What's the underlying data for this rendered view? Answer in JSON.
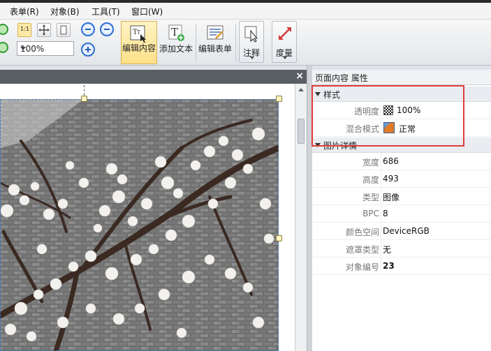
{
  "menu": [
    "表单(R)",
    "对象(B)",
    "工具(T)",
    "窗口(W)"
  ],
  "toolbar": {
    "zoom": "100%",
    "edit_content": "编辑内容",
    "add_text": "添加文本",
    "edit_form": "编辑表单",
    "annotate": "注释",
    "measure": "度量",
    "fit_label": "1:1"
  },
  "doc": {
    "close_glyph": "×"
  },
  "panel": {
    "title": "页面内容 属性",
    "style_group": "样式",
    "image_group": "图片详情",
    "style_props": [
      {
        "key": "透明度",
        "value": "100%"
      },
      {
        "key": "混合模式",
        "value": "正常"
      }
    ],
    "image_props": [
      {
        "key": "宽度",
        "value": "686"
      },
      {
        "key": "高度",
        "value": "493"
      },
      {
        "key": "类型",
        "value": "图像"
      },
      {
        "key": "BPC",
        "value": "8"
      },
      {
        "key": "颜色空间",
        "value": "DeviceRGB"
      },
      {
        "key": "遮罩类型",
        "value": "无"
      },
      {
        "key": "对象编号",
        "value": "23"
      }
    ]
  },
  "colors": {
    "highlight": "#e23b3b",
    "accent": "#fde08a"
  }
}
